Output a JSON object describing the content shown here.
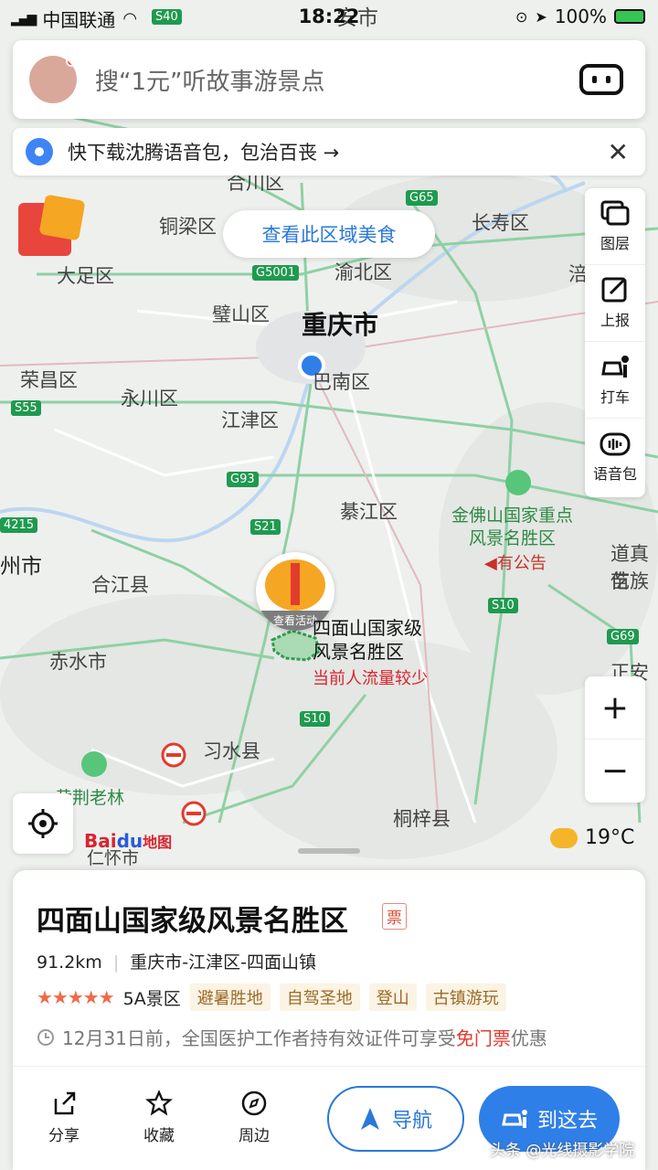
{
  "status": {
    "carrier": "中国联通",
    "time": "18:22",
    "battery": "100%"
  },
  "search": {
    "placeholder": "搜“1元”听故事游景点"
  },
  "notice": {
    "text": "快下载沈腾语音包，包治百丧 →",
    "close": "✕"
  },
  "food_button": "查看此区域美食",
  "side_tools": [
    {
      "label": "图层",
      "icon": "layers-icon"
    },
    {
      "label": "上报",
      "icon": "report-edit-icon"
    },
    {
      "label": "打车",
      "icon": "taxi-icon"
    },
    {
      "label": "语音包",
      "icon": "voice-pack-icon"
    }
  ],
  "zoom": {
    "plus": "+",
    "minus": "−"
  },
  "map": {
    "city_labels": [
      {
        "text": "重庆市",
        "size": "big"
      },
      {
        "text": "合川区"
      },
      {
        "text": "铜梁区"
      },
      {
        "text": "长寿区"
      },
      {
        "text": "大足区"
      },
      {
        "text": "渝北区"
      },
      {
        "text": "璧山区"
      },
      {
        "text": "荣昌区"
      },
      {
        "text": "巴南区"
      },
      {
        "text": "永川区"
      },
      {
        "text": "江津区"
      },
      {
        "text": "綦江区"
      },
      {
        "text": "合江县"
      },
      {
        "text": "赤水市"
      },
      {
        "text": "习水县"
      },
      {
        "text": "桐梓县"
      },
      {
        "text": "州市"
      },
      {
        "text": "黄荆老林"
      },
      {
        "text": "仁怀市"
      },
      {
        "text": "道真仡"
      },
      {
        "text": "苗族"
      },
      {
        "text": "正安县"
      },
      {
        "text": "涪"
      },
      {
        "text": "安市"
      }
    ],
    "road_shields": [
      "S40",
      "G65",
      "G5001",
      "S55",
      "G93",
      "S21",
      "S10",
      "S10",
      "G69",
      "4215"
    ],
    "poi_jinfo": {
      "name1": "金佛山国家重点",
      "name2": "风景名胜区",
      "badge": "有公告"
    },
    "poi_simian": {
      "name1": "四面山国家级",
      "name2": "风景名胜区",
      "crowd": "当前人流量较少",
      "activity": "查看活动"
    },
    "baidu_logo": {
      "bai": "Bai",
      "du": "du",
      "map": "地图"
    },
    "weather": "19°C"
  },
  "card": {
    "title": "四面山国家级风景名胜区",
    "ticket": "票",
    "distance": "91.2km",
    "address": "重庆市-江津区-四面山镇",
    "stars": "★★★★★",
    "level": "5A景区",
    "tags": [
      "避暑胜地",
      "自驾圣地",
      "登山",
      "古镇游玩"
    ],
    "promo_prefix": "12月31日前，全国医护工作者持有效证件可享受",
    "promo_highlight": "免门票",
    "promo_suffix": "优惠",
    "actions": [
      {
        "label": "分享",
        "icon": "share-icon"
      },
      {
        "label": "收藏",
        "icon": "star-icon"
      },
      {
        "label": "周边",
        "icon": "compass-icon"
      }
    ],
    "nav_label": "导航",
    "go_label": "到这去"
  },
  "watermark": "头条 @光线摄影学院",
  "colors": {
    "accent": "#2f7fe8",
    "road_shield": "#1f9a4f",
    "highlight": "#e23b2f"
  }
}
